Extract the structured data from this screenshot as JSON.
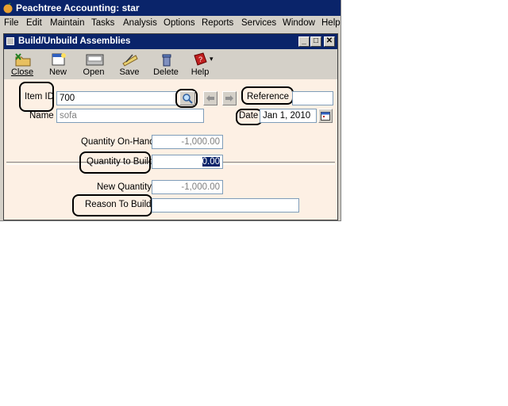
{
  "app": {
    "title": "Peachtree Accounting: star"
  },
  "menu": [
    "File",
    "Edit",
    "Maintain",
    "Tasks",
    "Analysis",
    "Options",
    "Reports",
    "Services",
    "Window",
    "Help"
  ],
  "window": {
    "title": "Build/Unbuild Assemblies",
    "min": "_",
    "max": "□",
    "close": "✕"
  },
  "toolbar": {
    "close": "Close",
    "new": "New",
    "open": "Open",
    "save": "Save",
    "delete": "Delete",
    "help": "Help",
    "help_arrow": "▾"
  },
  "form": {
    "item_id_label": "Item ID",
    "item_id_value": "700",
    "name_label": "Name",
    "name_value": "sofa",
    "reference_label": "Reference",
    "reference_value": "",
    "date_label": "Date",
    "date_value": "Jan 1, 2010",
    "qty_on_hand_label": "Quantity On-Hand",
    "qty_on_hand_value": "-1,000.00",
    "qty_to_build_label": "Quantity to Build",
    "qty_to_build_value": "0.00",
    "new_qty_label": "New Quantity",
    "new_qty_value": "-1,000.00",
    "reason_label": "Reason To Build",
    "reason_value": ""
  }
}
